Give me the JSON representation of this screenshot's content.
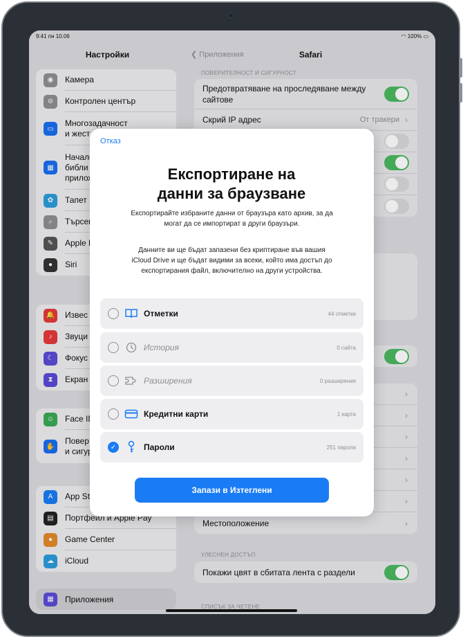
{
  "status": {
    "time": "9:41 пн 10.06",
    "battery": "100%"
  },
  "left": {
    "title": "Настройки",
    "group1": [
      {
        "label": "Камера",
        "icon": "camera-icon",
        "color": "#8e8e93"
      },
      {
        "label": "Контролен център",
        "icon": "control-center-icon",
        "color": "#8e8e93"
      },
      {
        "label": "Многозадачност\nи жест",
        "icon": "multitasking-icon",
        "color": "#1a6ef0"
      },
      {
        "label": "Начален\nбибли\nприлож",
        "icon": "home-screen-icon",
        "color": "#1a6ef0"
      },
      {
        "label": "Тапет",
        "icon": "wallpaper-icon",
        "color": "#2d9cdb"
      },
      {
        "label": "Търсен",
        "icon": "search-icon",
        "color": "#8e8e93"
      },
      {
        "label": "Apple P",
        "icon": "pencil-icon",
        "color": "#555"
      },
      {
        "label": "Siri",
        "icon": "siri-icon",
        "color": "#333"
      }
    ],
    "group2": [
      {
        "label": "Извес",
        "icon": "notifications-icon",
        "color": "#e5393b"
      },
      {
        "label": "Звуци",
        "icon": "sounds-icon",
        "color": "#e5393b"
      },
      {
        "label": "Фокус",
        "icon": "focus-icon",
        "color": "#5b4bd6"
      },
      {
        "label": "Екран",
        "icon": "screen-time-icon",
        "color": "#5b4bd6"
      }
    ],
    "group3": [
      {
        "label": "Face ID",
        "icon": "face-id-icon",
        "color": "#3aaa55"
      },
      {
        "label": "Повер\nи сигур",
        "icon": "privacy-icon",
        "color": "#1a6ef0"
      }
    ],
    "group4": [
      {
        "label": "App St",
        "icon": "app-store-icon",
        "color": "#1a7cf5"
      },
      {
        "label": "Портфейл и Apple Pay",
        "icon": "wallet-icon",
        "color": "#222"
      },
      {
        "label": "Game Center",
        "icon": "game-center-icon",
        "color": "#e28a2b"
      },
      {
        "label": "iCloud",
        "icon": "icloud-icon",
        "color": "#2d9cdb"
      }
    ],
    "apps": "Приложения"
  },
  "right": {
    "back": "Приложения",
    "title": "Safari",
    "sect1": "ПОВЕРИТЕЛНОСТ И СИГУРНОСТ",
    "r1": "Предотвратяване на проследяване между сайтове",
    "r2": "Скрий IP адрес",
    "r2val": "От тракери",
    "location": "Местоположение",
    "sect2": "УЛЕСНЕН ДОСТЪП",
    "r3": "Покажи цвят в сбитата лента с раздели",
    "sect3": "СПИСЪК ЗА ЧЕТЕНЕ"
  },
  "modal": {
    "cancel": "Отказ",
    "title": "Експортиране на данни за браузване",
    "p1": "Експортирайте избраните данни от браузъра като архив, за да могат да се импортират в други браузъри.",
    "p2": "Данните ви ще бъдат запазени без криптиране във вашия iCloud Drive и ще бъдат видими за всеки, който има достъп до експортирания файл, включително на други устройства.",
    "options": [
      {
        "label": "Отметки",
        "count": "44 отметки",
        "enabled": true,
        "checked": false,
        "icon": "book-icon"
      },
      {
        "label": "История",
        "count": "0 сайта",
        "enabled": false,
        "checked": false,
        "icon": "clock-icon"
      },
      {
        "label": "Разширения",
        "count": "0 разширения",
        "enabled": false,
        "checked": false,
        "icon": "extension-icon"
      },
      {
        "label": "Кредитни карти",
        "count": "1 карта",
        "enabled": true,
        "checked": false,
        "icon": "credit-card-icon"
      },
      {
        "label": "Пароли",
        "count": "251 пароли",
        "enabled": true,
        "checked": true,
        "icon": "key-icon"
      }
    ],
    "save": "Запази в Изтеглени"
  }
}
